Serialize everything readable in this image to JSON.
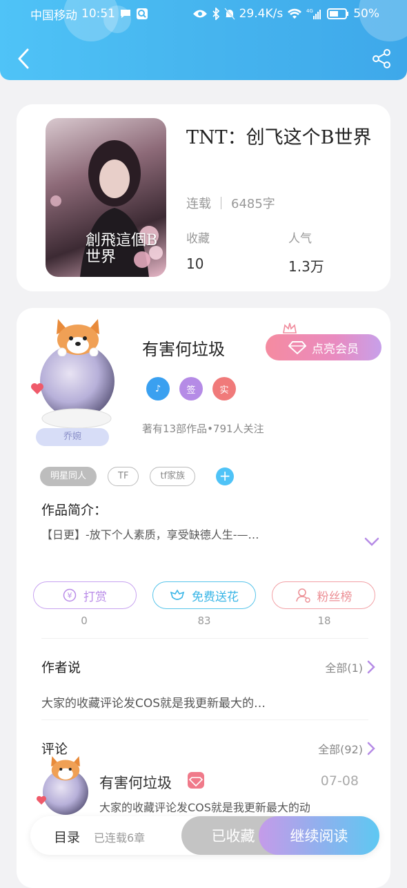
{
  "status_bar": {
    "carrier": "中国移动",
    "time": "10:51",
    "speed": "29.4K/s",
    "network": "4G",
    "battery": "50%"
  },
  "book": {
    "title": "TNT：创飞这个B世界",
    "cover_text": "創飛這個B世界",
    "status": "连载",
    "word_count": "6485字",
    "favorites_label": "收藏",
    "favorites_value": "10",
    "popularity_label": "人气",
    "popularity_value": "1.3万"
  },
  "author": {
    "name": "有害何垃圾",
    "plate": "乔婉",
    "vip_button": "点亮会员",
    "badges": [
      {
        "text": "♪",
        "color": "#3aa0f0"
      },
      {
        "text": "签",
        "color": "#b58be6"
      },
      {
        "text": "实",
        "color": "#f07a7a"
      }
    ],
    "stats": "著有13部作品•791人关注"
  },
  "tags": [
    "明星同人",
    "TF",
    "tf家族"
  ],
  "intro": {
    "title": "作品简介：",
    "text": "【日更】-放下个人素质，享受缺德人生-—…"
  },
  "actions": {
    "reward": {
      "label": "打赏",
      "count": "0"
    },
    "flower": {
      "label": "免费送花",
      "count": "83"
    },
    "fans": {
      "label": "粉丝榜",
      "count": "18"
    }
  },
  "author_says": {
    "title": "作者说",
    "more": "全部(1)",
    "text": "大家的收藏评论发COS就是我更新最大的…"
  },
  "comments": {
    "title": "评论",
    "more": "全部(92)",
    "item": {
      "name": "有害何垃圾",
      "date": "07-08",
      "text": "大家的收藏评论发COS就是我更新最大的动"
    }
  },
  "bottom_bar": {
    "toc": "目录",
    "chapters": "已连载6章",
    "collected": "已收藏",
    "continue": "继续阅读"
  },
  "colors": {
    "header": "#47b6ef",
    "accent_blue": "#4fc3f7"
  }
}
